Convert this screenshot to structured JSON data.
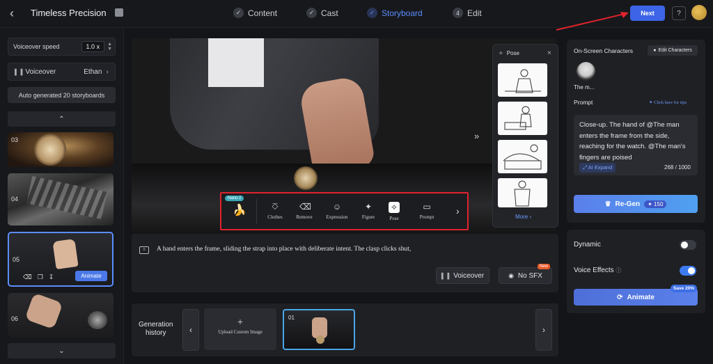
{
  "header": {
    "project_title": "Timeless Precision",
    "steps": [
      {
        "label": "Content",
        "marker": "✓"
      },
      {
        "label": "Cast",
        "marker": "✓"
      },
      {
        "label": "Storyboard",
        "marker": "✓"
      },
      {
        "label": "Edit",
        "marker": "4"
      }
    ],
    "next_label": "Next",
    "help_icon": "?"
  },
  "left": {
    "voiceover_speed_label": "Voiceover speed",
    "voiceover_speed_value": "1.0",
    "voiceover_speed_unit": "x",
    "voiceover_label": "Voiceover",
    "voiceover_voice": "Ethan",
    "auto_generated": "Auto generated 20 storyboards",
    "scenes": [
      {
        "num": "03"
      },
      {
        "num": "04"
      },
      {
        "num": "05",
        "action": "Animate"
      },
      {
        "num": "06"
      }
    ]
  },
  "pose_panel": {
    "title": "Pose",
    "more": "More"
  },
  "toolbar": {
    "badge": "Nano 2",
    "tools": [
      "Clothes",
      "Remove",
      "Expression",
      "Figure",
      "Pose",
      "Prompt"
    ]
  },
  "description": {
    "text": "A hand enters the frame, sliding the strap into place with deliberate intent. The clasp clicks shut,",
    "voiceover_btn": "Voiceover",
    "sfx_btn": "No SFX",
    "new_badge": "New"
  },
  "history": {
    "label_line1": "Generation",
    "label_line2": "history",
    "upload": "Upload Custom Image",
    "item_num": "01"
  },
  "right": {
    "characters_title": "On-Screen Characters",
    "edit_characters": "Edit Characters",
    "character_name": "The m...",
    "prompt_label": "Prompt",
    "tips": "Click here for tips",
    "prompt_text": "Close-up. The hand of @The man enters the frame from the side, reaching for the watch. @The man's fingers are poised",
    "ai_expand": "AI Expand",
    "count": "268 / 1000",
    "regen": "Re-Gen",
    "regen_cost": "150",
    "dynamic": "Dynamic",
    "voice_effects": "Voice Effects",
    "animate": "Animate",
    "save_badge": "Save 20%"
  },
  "colors": {
    "accent": "#3d64e6",
    "annotation": "#e0232d",
    "toggle_on": "#3d7bf0"
  }
}
